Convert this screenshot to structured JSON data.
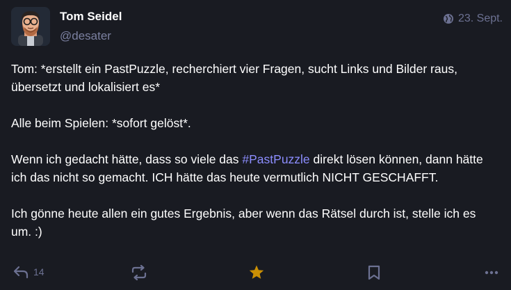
{
  "author": {
    "display_name": "Tom Seidel",
    "handle": "@desater",
    "avatar_icon": "avatar-illustration"
  },
  "meta": {
    "visibility_icon": "globe-icon",
    "date": "23. Sept."
  },
  "content": {
    "paragraph1": "Tom: *erstellt ein PastPuzzle, recherchiert vier Fragen, sucht Links und Bilder raus, übersetzt und lokalisiert es*",
    "paragraph2": "Alle beim Spielen: *sofort gelöst*.",
    "paragraph3_before": "Wenn ich gedacht hätte, dass so viele das ",
    "paragraph3_hashtag": "#PastPuzzle",
    "paragraph3_after": " direkt lösen können, dann hätte ich das nicht so gemacht. ICH hätte das heute vermutlich NICHT GESCHAFFT.",
    "paragraph4": "Ich gönne heute allen ein gutes Ergebnis, aber wenn das Rätsel durch ist, stelle ich es um. :)"
  },
  "actions": {
    "reply_count": "14",
    "favourited": true,
    "icons": [
      "reply-icon",
      "boost-icon",
      "star-icon",
      "bookmark-icon",
      "more-icon"
    ]
  },
  "colors": {
    "background": "#191b22",
    "text": "#ffffff",
    "muted": "#6c7192",
    "hashtag": "#8c8dff",
    "favourite": "#ca8f04"
  }
}
